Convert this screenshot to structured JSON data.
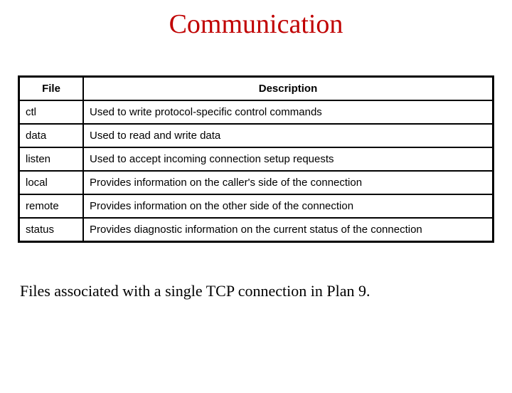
{
  "title": "Communication",
  "table": {
    "headers": {
      "file": "File",
      "description": "Description"
    },
    "rows": [
      {
        "file": "ctl",
        "desc": "Used to write protocol-specific control commands"
      },
      {
        "file": "data",
        "desc": "Used to read and write data"
      },
      {
        "file": "listen",
        "desc": "Used to accept incoming connection setup requests"
      },
      {
        "file": "local",
        "desc": "Provides information on the caller's side of the connection"
      },
      {
        "file": "remote",
        "desc": "Provides information on the other side of the connection"
      },
      {
        "file": "status",
        "desc": "Provides diagnostic information on the current status of the connection"
      }
    ]
  },
  "caption": "Files associated with a single TCP connection in Plan 9."
}
